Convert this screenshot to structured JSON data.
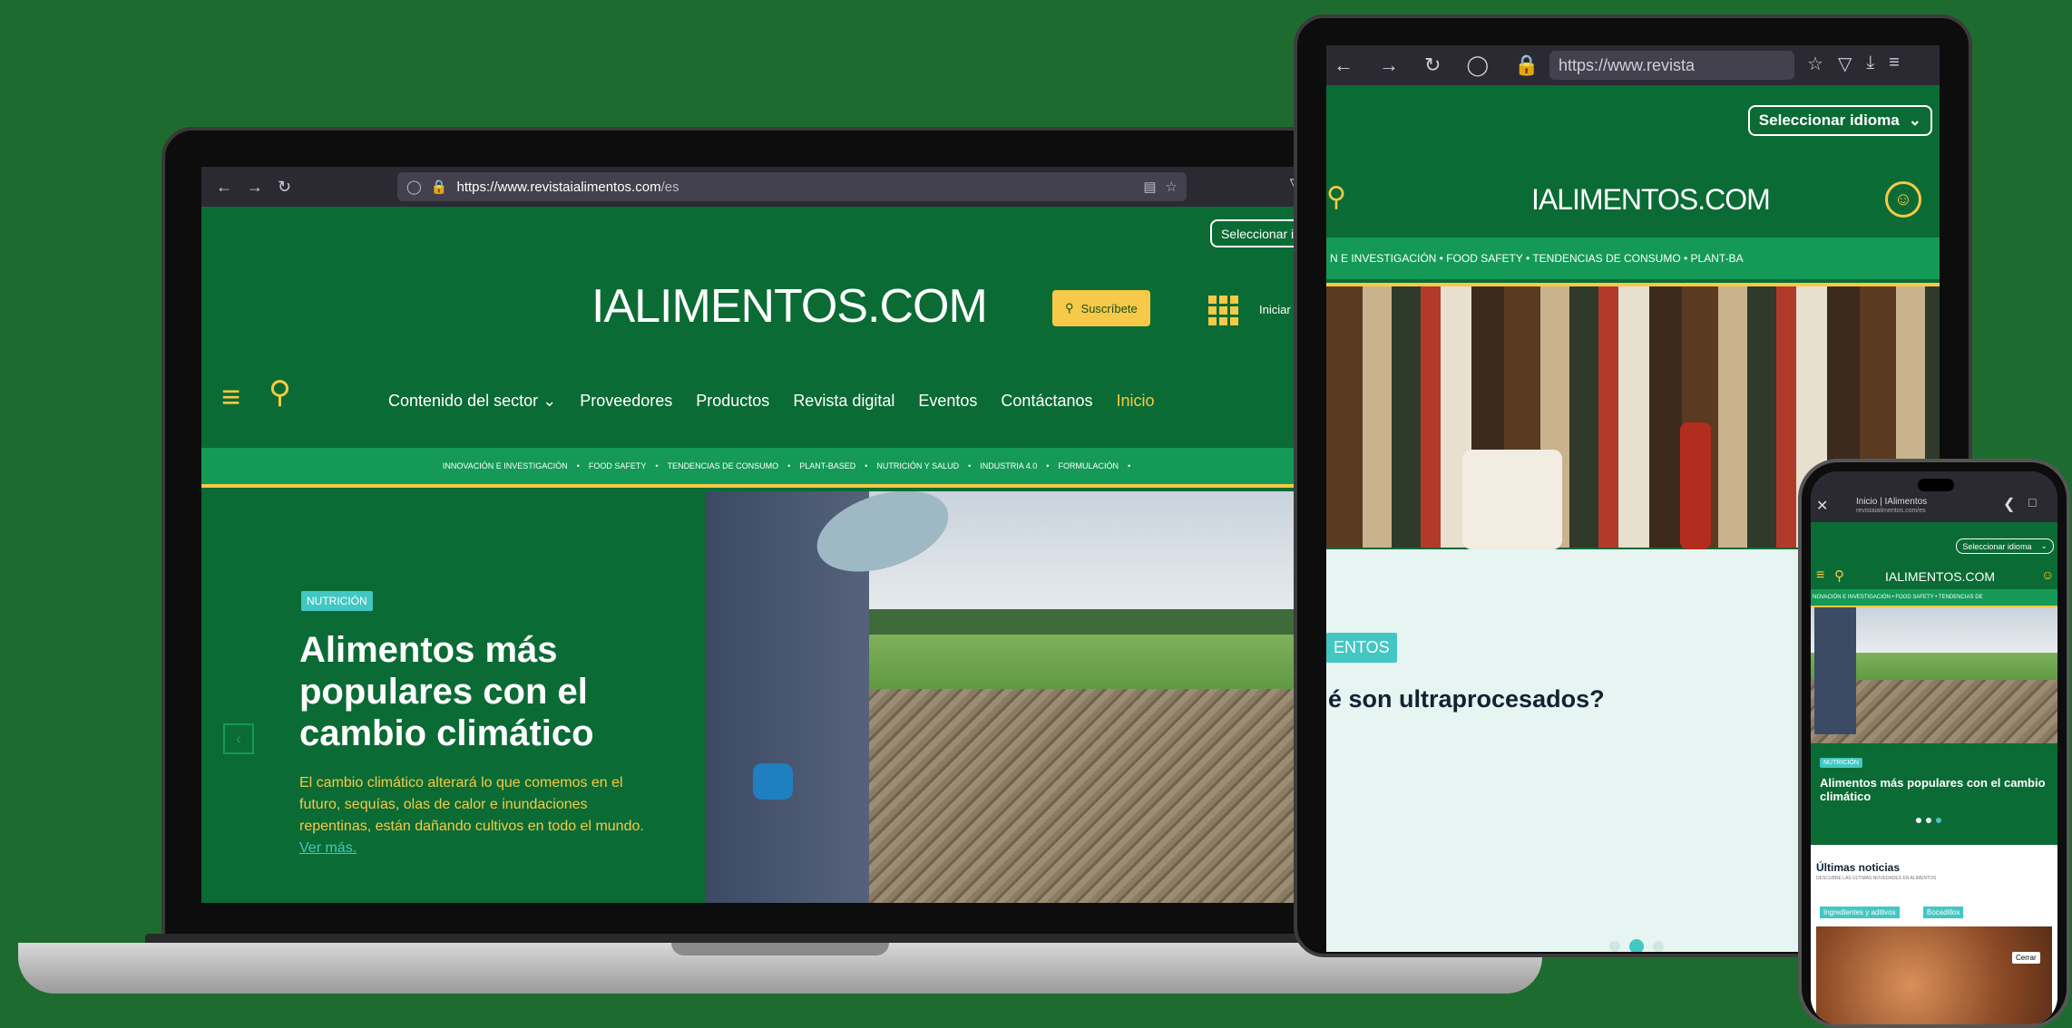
{
  "browser": {
    "url_host": "https://www.revistaialimentos.com",
    "url_path": "/es",
    "tablet_url": "https://www.revista",
    "icons": [
      "back-icon",
      "forward-icon",
      "reload-icon",
      "shield-icon",
      "lock-icon",
      "reader-icon",
      "star-icon",
      "pocket-icon",
      "download-icon",
      "menu-icon"
    ]
  },
  "site": {
    "language_select": "Seleccionar idioma",
    "logo": "IALIMENTOS.COM",
    "subscribe": "Suscríbete",
    "login": "Iniciar sesión",
    "nav": [
      "Contenido del sector",
      "Proveedores",
      "Productos",
      "Revista digital",
      "Eventos",
      "Contáctanos",
      "Inicio"
    ],
    "categories": [
      "INNOVACIÓN E INVESTIGACIÓN",
      "FOOD SAFETY",
      "TENDENCIAS DE CONSUMO",
      "PLANT-BASED",
      "NUTRICIÓN Y SALUD",
      "INDUSTRIA 4.0",
      "FORMULACIÓN"
    ],
    "accent": "#f6c948",
    "brand_green": "#0b6b34",
    "strip_green": "#149a56",
    "badge_color": "#43c7c2"
  },
  "hero": {
    "badge": "NUTRICIÓN",
    "title": "Alimentos más populares con el cambio climático",
    "body": "El cambio climático alterará lo que comemos en el futuro, sequías, olas de calor e inundaciones repentinas, están dañando cultivos en todo el mundo.",
    "more": "Ver más."
  },
  "tablet": {
    "categories": "N E INVESTIGACIÓN  •  FOOD SAFETY  •  TENDENCIAS DE CONSUMO  •  PLANT-BA",
    "badge": "ENTOS",
    "title": "é son ultraprocesados?"
  },
  "phone": {
    "tab_title": "Inicio | IAlimentos",
    "tab_url": "revistaialimentos.com/es",
    "language_select": "Seleccionar idioma",
    "logo": "IALIMENTOS.COM",
    "categories": "NOVACIÓN E INVESTIGACIÓN  •  FOOD SAFETY  •  TENDENCIAS DE",
    "badge": "NUTRICIÓN",
    "title": "Alimentos más populares con el cambio climático",
    "news_heading": "Últimas noticias",
    "news_sub": "DESCUBRE LAS ÚLTIMAS NOVEDADES EN ALIMENTOS",
    "tags": [
      "Ingredientes y aditivos",
      "Bocadillos"
    ],
    "close": "Cerrar"
  }
}
